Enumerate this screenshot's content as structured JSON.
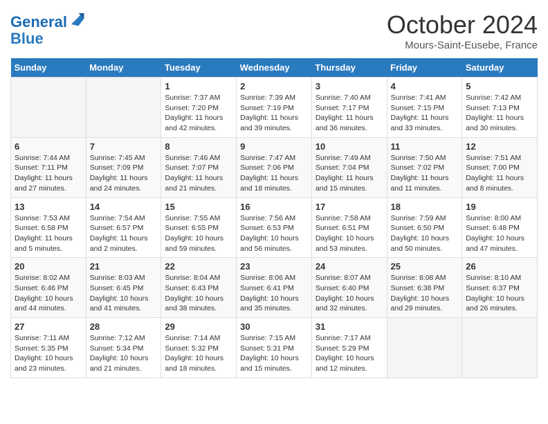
{
  "header": {
    "logo_line1": "General",
    "logo_line2": "Blue",
    "month_title": "October 2024",
    "location": "Mours-Saint-Eusebe, France"
  },
  "weekdays": [
    "Sunday",
    "Monday",
    "Tuesday",
    "Wednesday",
    "Thursday",
    "Friday",
    "Saturday"
  ],
  "weeks": [
    [
      {
        "day": "",
        "sunrise": "",
        "sunset": "",
        "daylight": ""
      },
      {
        "day": "",
        "sunrise": "",
        "sunset": "",
        "daylight": ""
      },
      {
        "day": "1",
        "sunrise": "Sunrise: 7:37 AM",
        "sunset": "Sunset: 7:20 PM",
        "daylight": "Daylight: 11 hours and 42 minutes."
      },
      {
        "day": "2",
        "sunrise": "Sunrise: 7:39 AM",
        "sunset": "Sunset: 7:19 PM",
        "daylight": "Daylight: 11 hours and 39 minutes."
      },
      {
        "day": "3",
        "sunrise": "Sunrise: 7:40 AM",
        "sunset": "Sunset: 7:17 PM",
        "daylight": "Daylight: 11 hours and 36 minutes."
      },
      {
        "day": "4",
        "sunrise": "Sunrise: 7:41 AM",
        "sunset": "Sunset: 7:15 PM",
        "daylight": "Daylight: 11 hours and 33 minutes."
      },
      {
        "day": "5",
        "sunrise": "Sunrise: 7:42 AM",
        "sunset": "Sunset: 7:13 PM",
        "daylight": "Daylight: 11 hours and 30 minutes."
      }
    ],
    [
      {
        "day": "6",
        "sunrise": "Sunrise: 7:44 AM",
        "sunset": "Sunset: 7:11 PM",
        "daylight": "Daylight: 11 hours and 27 minutes."
      },
      {
        "day": "7",
        "sunrise": "Sunrise: 7:45 AM",
        "sunset": "Sunset: 7:09 PM",
        "daylight": "Daylight: 11 hours and 24 minutes."
      },
      {
        "day": "8",
        "sunrise": "Sunrise: 7:46 AM",
        "sunset": "Sunset: 7:07 PM",
        "daylight": "Daylight: 11 hours and 21 minutes."
      },
      {
        "day": "9",
        "sunrise": "Sunrise: 7:47 AM",
        "sunset": "Sunset: 7:06 PM",
        "daylight": "Daylight: 11 hours and 18 minutes."
      },
      {
        "day": "10",
        "sunrise": "Sunrise: 7:49 AM",
        "sunset": "Sunset: 7:04 PM",
        "daylight": "Daylight: 11 hours and 15 minutes."
      },
      {
        "day": "11",
        "sunrise": "Sunrise: 7:50 AM",
        "sunset": "Sunset: 7:02 PM",
        "daylight": "Daylight: 11 hours and 11 minutes."
      },
      {
        "day": "12",
        "sunrise": "Sunrise: 7:51 AM",
        "sunset": "Sunset: 7:00 PM",
        "daylight": "Daylight: 11 hours and 8 minutes."
      }
    ],
    [
      {
        "day": "13",
        "sunrise": "Sunrise: 7:53 AM",
        "sunset": "Sunset: 6:58 PM",
        "daylight": "Daylight: 11 hours and 5 minutes."
      },
      {
        "day": "14",
        "sunrise": "Sunrise: 7:54 AM",
        "sunset": "Sunset: 6:57 PM",
        "daylight": "Daylight: 11 hours and 2 minutes."
      },
      {
        "day": "15",
        "sunrise": "Sunrise: 7:55 AM",
        "sunset": "Sunset: 6:55 PM",
        "daylight": "Daylight: 10 hours and 59 minutes."
      },
      {
        "day": "16",
        "sunrise": "Sunrise: 7:56 AM",
        "sunset": "Sunset: 6:53 PM",
        "daylight": "Daylight: 10 hours and 56 minutes."
      },
      {
        "day": "17",
        "sunrise": "Sunrise: 7:58 AM",
        "sunset": "Sunset: 6:51 PM",
        "daylight": "Daylight: 10 hours and 53 minutes."
      },
      {
        "day": "18",
        "sunrise": "Sunrise: 7:59 AM",
        "sunset": "Sunset: 6:50 PM",
        "daylight": "Daylight: 10 hours and 50 minutes."
      },
      {
        "day": "19",
        "sunrise": "Sunrise: 8:00 AM",
        "sunset": "Sunset: 6:48 PM",
        "daylight": "Daylight: 10 hours and 47 minutes."
      }
    ],
    [
      {
        "day": "20",
        "sunrise": "Sunrise: 8:02 AM",
        "sunset": "Sunset: 6:46 PM",
        "daylight": "Daylight: 10 hours and 44 minutes."
      },
      {
        "day": "21",
        "sunrise": "Sunrise: 8:03 AM",
        "sunset": "Sunset: 6:45 PM",
        "daylight": "Daylight: 10 hours and 41 minutes."
      },
      {
        "day": "22",
        "sunrise": "Sunrise: 8:04 AM",
        "sunset": "Sunset: 6:43 PM",
        "daylight": "Daylight: 10 hours and 38 minutes."
      },
      {
        "day": "23",
        "sunrise": "Sunrise: 8:06 AM",
        "sunset": "Sunset: 6:41 PM",
        "daylight": "Daylight: 10 hours and 35 minutes."
      },
      {
        "day": "24",
        "sunrise": "Sunrise: 8:07 AM",
        "sunset": "Sunset: 6:40 PM",
        "daylight": "Daylight: 10 hours and 32 minutes."
      },
      {
        "day": "25",
        "sunrise": "Sunrise: 8:08 AM",
        "sunset": "Sunset: 6:38 PM",
        "daylight": "Daylight: 10 hours and 29 minutes."
      },
      {
        "day": "26",
        "sunrise": "Sunrise: 8:10 AM",
        "sunset": "Sunset: 6:37 PM",
        "daylight": "Daylight: 10 hours and 26 minutes."
      }
    ],
    [
      {
        "day": "27",
        "sunrise": "Sunrise: 7:11 AM",
        "sunset": "Sunset: 5:35 PM",
        "daylight": "Daylight: 10 hours and 23 minutes."
      },
      {
        "day": "28",
        "sunrise": "Sunrise: 7:12 AM",
        "sunset": "Sunset: 5:34 PM",
        "daylight": "Daylight: 10 hours and 21 minutes."
      },
      {
        "day": "29",
        "sunrise": "Sunrise: 7:14 AM",
        "sunset": "Sunset: 5:32 PM",
        "daylight": "Daylight: 10 hours and 18 minutes."
      },
      {
        "day": "30",
        "sunrise": "Sunrise: 7:15 AM",
        "sunset": "Sunset: 5:31 PM",
        "daylight": "Daylight: 10 hours and 15 minutes."
      },
      {
        "day": "31",
        "sunrise": "Sunrise: 7:17 AM",
        "sunset": "Sunset: 5:29 PM",
        "daylight": "Daylight: 10 hours and 12 minutes."
      },
      {
        "day": "",
        "sunrise": "",
        "sunset": "",
        "daylight": ""
      },
      {
        "day": "",
        "sunrise": "",
        "sunset": "",
        "daylight": ""
      }
    ]
  ]
}
